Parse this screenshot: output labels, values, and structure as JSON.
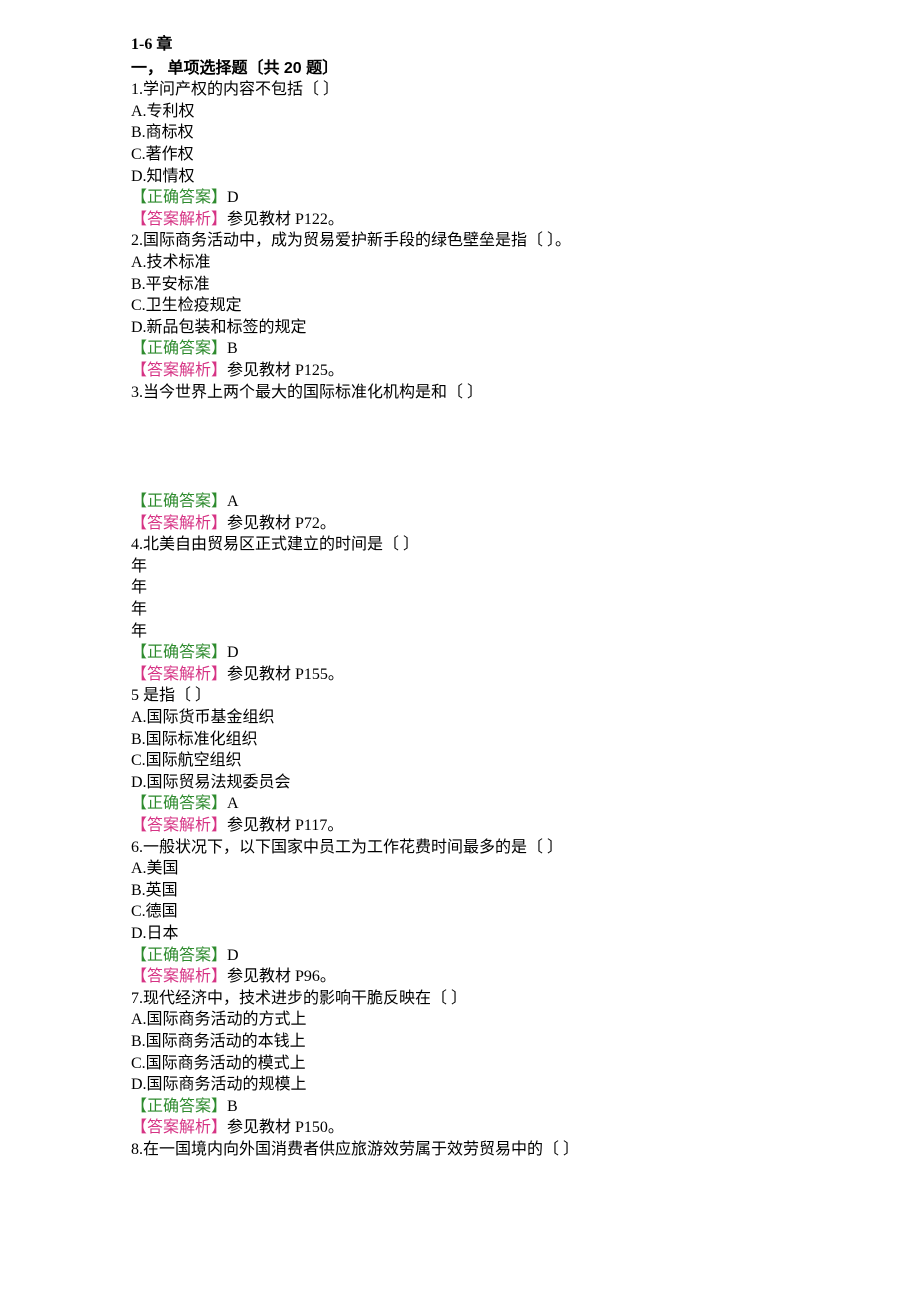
{
  "chapter": "1-6 章",
  "section": "一， 单项选择题〔共 20 题〕",
  "labels": {
    "correct_prefix": "【正确答案】",
    "analysis_prefix": "【答案解析】"
  },
  "questions": [
    {
      "stem": "1.学问产权的内容不包括〔  〕",
      "options": [
        "A.专利权",
        "B.商标权",
        "C.著作权",
        "D.知情权"
      ],
      "correct": "D",
      "analysis": "参见教材 P122。"
    },
    {
      "stem": "2.国际商务活动中，成为贸易爱护新手段的绿色壁垒是指〔  〕。",
      "options": [
        "A.技术标准",
        "B.平安标准",
        "C.卫生检疫规定",
        "D.新品包装和标签的规定"
      ],
      "correct": "B",
      "analysis": "参见教材 P125。"
    },
    {
      "stem": "3.当今世界上两个最大的国际标准化机构是和〔  〕",
      "options": [],
      "correct": "A",
      "analysis": "参见教材 P72。"
    },
    {
      "stem": "4.北美自由贸易区正式建立的时间是〔  〕",
      "options": [
        "年",
        "年",
        "年",
        "年"
      ],
      "correct": "D",
      "analysis": "参见教材 P155。"
    },
    {
      "stem": "5 是指〔  〕",
      "options": [
        "A.国际货币基金组织",
        "B.国际标准化组织",
        "C.国际航空组织",
        "D.国际贸易法规委员会"
      ],
      "correct": "A",
      "analysis": "参见教材 P117。"
    },
    {
      "stem": "6.一般状况下，以下国家中员工为工作花费时间最多的是〔  〕",
      "options": [
        "A.美国",
        "B.英国",
        "C.德国",
        "D.日本"
      ],
      "correct": "D",
      "analysis": "参见教材 P96。"
    },
    {
      "stem": "7.现代经济中，技术进步的影响干脆反映在〔  〕",
      "options": [
        "A.国际商务活动的方式上",
        "B.国际商务活动的本钱上",
        "C.国际商务活动的模式上",
        "D.国际商务活动的规模上"
      ],
      "correct": "B",
      "analysis": "参见教材 P150。"
    },
    {
      "stem": "8.在一国境内向外国消费者供应旅游效劳属于效劳贸易中的〔  〕",
      "options": [],
      "correct": "",
      "analysis": ""
    }
  ]
}
